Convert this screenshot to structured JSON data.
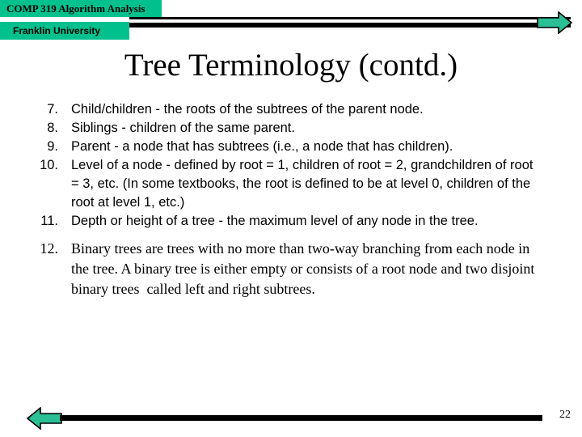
{
  "header": {
    "course_title": "COMP 319  Algorithm Analysis",
    "institution": "Franklin University",
    "accent_color": "#00C18E",
    "rule_color": "#000000",
    "forward_arrow_icon": "arrow-right-icon"
  },
  "slide": {
    "title": "Tree Terminology (contd.)",
    "items": [
      {
        "number": "7.",
        "text": "Child/children - the roots of the subtrees of the parent node.",
        "style": "sans"
      },
      {
        "number": "8.",
        "text": "Siblings - children of the same parent.",
        "style": "sans"
      },
      {
        "number": "9.",
        "text": "Parent - a node that has subtrees (i.e., a node that has children).",
        "style": "sans"
      },
      {
        "number": "10.",
        "text": "Level of a node - defined by root = 1, children of root = 2, grandchildren of root = 3, etc. (In some textbooks, the root is defined to be at level 0, children of the root at level 1, etc.)",
        "style": "sans"
      },
      {
        "number": "11.",
        "text": "Depth or height of a tree - the maximum level of any node in the tree.",
        "style": "sans"
      },
      {
        "number": "12.",
        "text": "Binary trees are trees with no more than two-way branching from each node in the tree. A binary tree is either empty or consists of a root node and two disjoint binary trees  called left and right subtrees.",
        "style": "serif"
      }
    ]
  },
  "footer": {
    "back_arrow_icon": "arrow-left-icon",
    "page_number": "22",
    "accent_color": "#00C18E"
  }
}
